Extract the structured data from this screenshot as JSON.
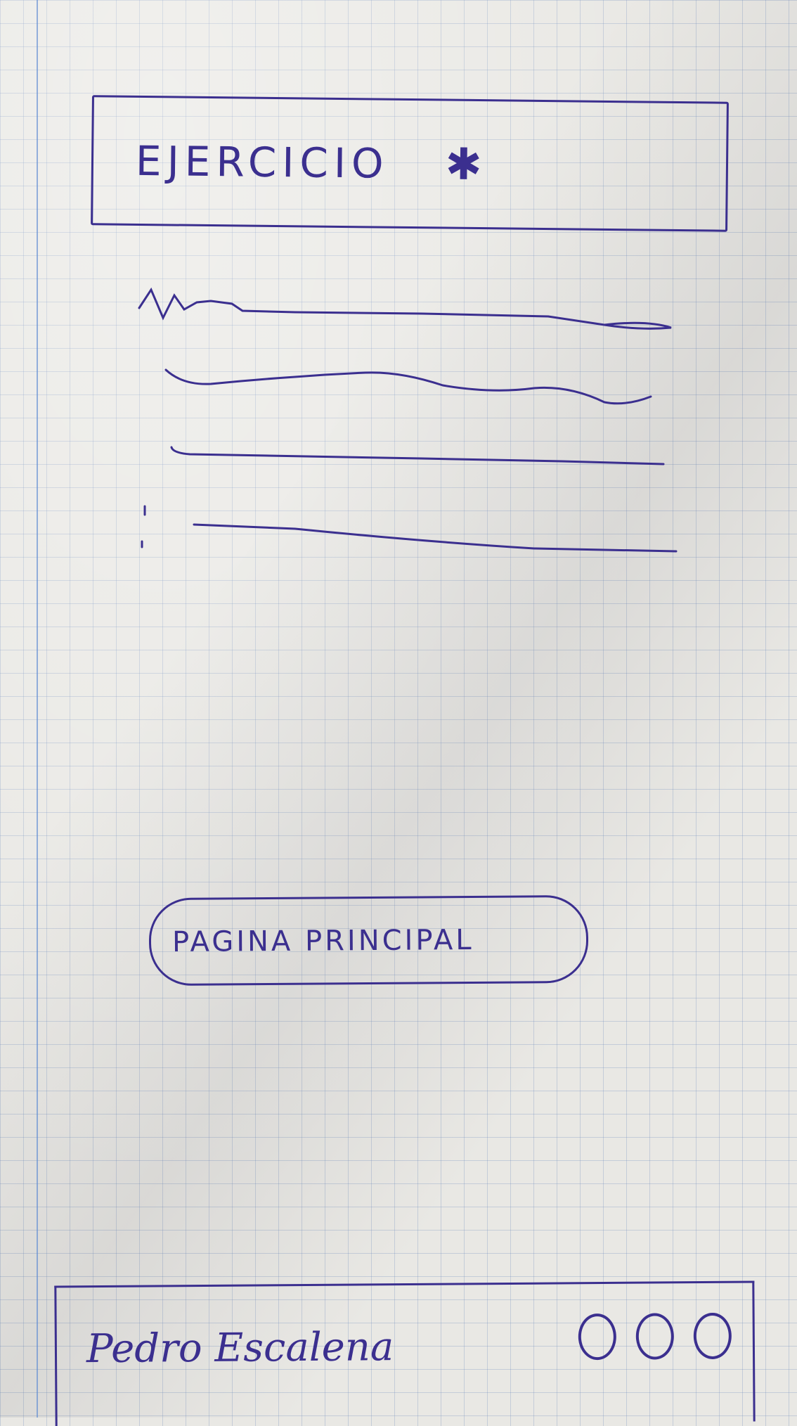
{
  "header": {
    "title": "EJERCICIO",
    "star_icon": "asterisk-icon",
    "star_glyph": "✱"
  },
  "content": {
    "placeholder_lines": [
      "text-line-1",
      "text-line-2",
      "text-line-3",
      "text-line-4"
    ]
  },
  "main_button": {
    "label": "PAGINA   PRINCIPAL"
  },
  "footer": {
    "name": "Pedro  Escalena",
    "menu_icon": "more-options-icon"
  },
  "colors": {
    "ink": "#3b2f8f",
    "paper": "#e9e8e4",
    "grid": "#6e8cbe"
  }
}
